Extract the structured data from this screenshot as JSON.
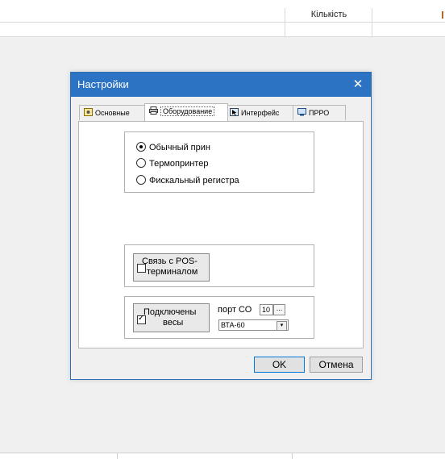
{
  "background": {
    "column_header": "Кількість"
  },
  "dialog": {
    "title": "Настройки",
    "tabs": [
      {
        "label": "Основные",
        "icon": "settings-icon"
      },
      {
        "label": "Оборудование",
        "icon": "printer-icon"
      },
      {
        "label": "Интерфейс",
        "icon": "cursor-icon"
      },
      {
        "label": "ПРРО",
        "icon": "monitor-icon"
      }
    ],
    "printer_type": {
      "options": [
        "Обычный прин",
        "Термопринтер",
        "Фискальный регистра"
      ],
      "selected": "Обычный прин"
    },
    "pos_terminal": {
      "label_line1": "Связь с POS-",
      "label_line2": "терминалом",
      "checked": false
    },
    "scales": {
      "label_line1": "Подключены",
      "label_line2": "весы",
      "checked": true,
      "port_label": "порт СО",
      "port_value": "10",
      "browse": "...",
      "model": "ВТА-60"
    },
    "ok_label": "OK",
    "cancel_label": "Отмена"
  }
}
